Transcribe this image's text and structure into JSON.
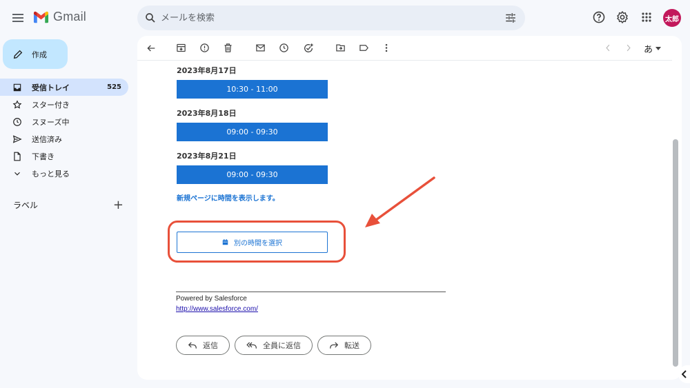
{
  "app": {
    "name": "Gmail",
    "brand_colors": {
      "red": "#EA4335",
      "blue": "#4285F4",
      "green": "#34A853",
      "yellow": "#FBBC04"
    }
  },
  "search": {
    "placeholder": "メールを検索",
    "value": ""
  },
  "user": {
    "avatar_text": "太郎",
    "avatar_color": "#c2185b"
  },
  "sidebar": {
    "compose_label": "作成",
    "items": [
      {
        "label": "受信トレイ",
        "count": "525",
        "icon": "inbox-icon",
        "active": true
      },
      {
        "label": "スター付き",
        "icon": "star-icon"
      },
      {
        "label": "スヌーズ中",
        "icon": "clock-icon"
      },
      {
        "label": "送信済み",
        "icon": "send-icon"
      },
      {
        "label": "下書き",
        "icon": "draft-icon"
      },
      {
        "label": "もっと見る",
        "icon": "chevron-down-icon"
      }
    ],
    "labels_heading": "ラベル",
    "labels_add": "+"
  },
  "toolbar": {
    "icons": [
      "back-arrow-icon",
      "archive-icon",
      "report-spam-icon",
      "delete-icon",
      "mark-unread-icon",
      "snooze-icon",
      "add-task-icon",
      "move-to-icon",
      "label-icon",
      "more-icon"
    ],
    "input_language": "あ"
  },
  "email": {
    "slots": [
      {
        "date": "2023年8月17日",
        "time": "10:30 - 11:00"
      },
      {
        "date": "2023年8月18日",
        "time": "09:00 - 09:30"
      },
      {
        "date": "2023年8月21日",
        "time": "09:00 - 09:30"
      }
    ],
    "new_page_link": "新規ページに時間を表示します。",
    "other_time_button": "別の時間を選択",
    "powered_by": "Powered by Salesforce",
    "salesforce_link": "http://www.salesforce.com/",
    "accent_color": "#1b73d3",
    "annotation_color": "#e8503a"
  },
  "reply_actions": {
    "reply": "返信",
    "reply_all": "全員に返信",
    "forward": "転送"
  }
}
